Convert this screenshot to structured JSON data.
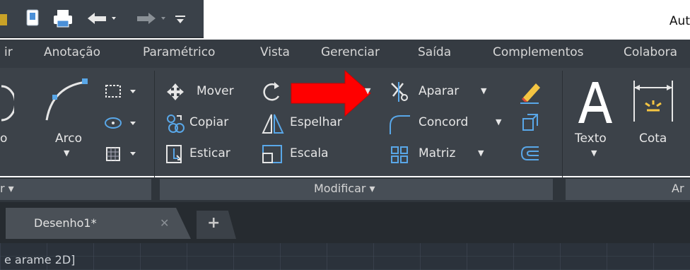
{
  "app": {
    "title": "Aut"
  },
  "menu_tabs": [
    {
      "label": "ir"
    },
    {
      "label": "Anotação"
    },
    {
      "label": "Paramétrico"
    },
    {
      "label": "Vista"
    },
    {
      "label": "Gerenciar"
    },
    {
      "label": "Saída"
    },
    {
      "label": "Complementos"
    },
    {
      "label": "Colabora"
    }
  ],
  "ribbon": {
    "draw": {
      "partial_label": "o",
      "arc_label": "Arco",
      "panel_title": "r"
    },
    "modify": {
      "move": "Mover",
      "copy": "Copiar",
      "stretch": "Esticar",
      "mirror": "Espelhar",
      "scale": "Escala",
      "trim": "Aparar",
      "fillet": "Concord",
      "array": "Matriz",
      "panel_title": "Modificar"
    },
    "annotation": {
      "text": "Texto",
      "dim": "Cota",
      "panel_title": "Ar"
    }
  },
  "doc_tabs": {
    "active": "Desenho1*",
    "close_glyph": "✕",
    "new_glyph": "+"
  },
  "viewport": {
    "label": "e arame 2D]"
  }
}
